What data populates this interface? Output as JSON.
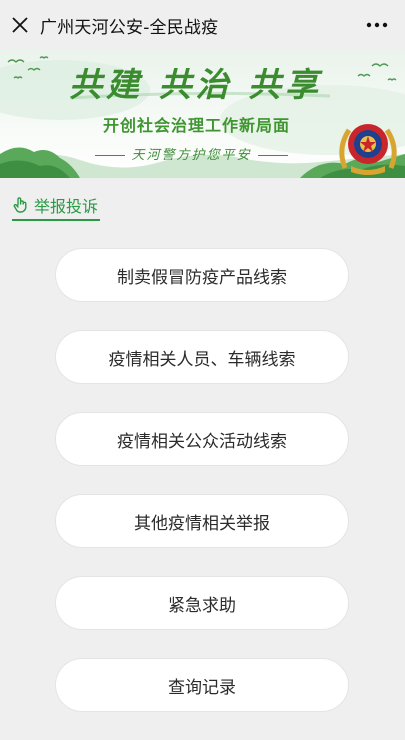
{
  "window": {
    "title": "广州天河公安-全民战疫",
    "close_icon": "close-icon",
    "more_icon": "more-dots-icon"
  },
  "banner": {
    "slogan": "共建 共治 共享",
    "subtitle": "开创社会治理工作新局面",
    "motto": "天河警方护您平安",
    "emblem_icon": "police-emblem-icon",
    "colors": {
      "slogan": "#3b8c2f",
      "hills": "#5aa95a"
    }
  },
  "section_tab": {
    "label": "举报投诉",
    "icon": "hand-pointer-icon",
    "color": "#2a9a45"
  },
  "menu": {
    "items": [
      {
        "label": "制卖假冒防疫产品线索"
      },
      {
        "label": "疫情相关人员、车辆线索"
      },
      {
        "label": "疫情相关公众活动线索"
      },
      {
        "label": "其他疫情相关举报"
      },
      {
        "label": "紧急求助"
      },
      {
        "label": "查询记录"
      }
    ]
  }
}
